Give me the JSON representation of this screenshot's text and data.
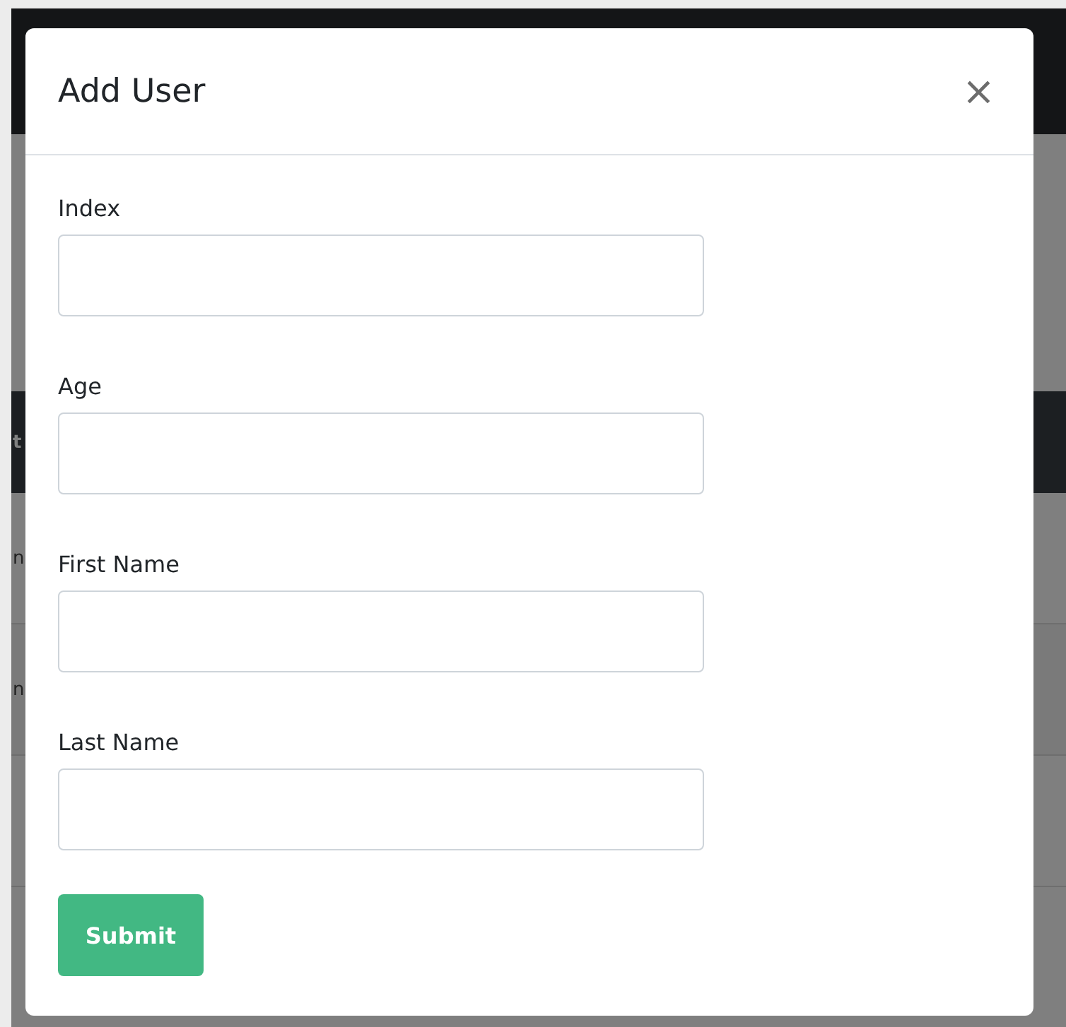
{
  "background": {
    "table_header": "t",
    "rows": [
      {
        "text": "n"
      },
      {
        "text": "n"
      }
    ]
  },
  "modal": {
    "title": "Add User",
    "close": "×",
    "fields": [
      {
        "label": "Index"
      },
      {
        "label": "Age"
      },
      {
        "label": "First Name"
      },
      {
        "label": "Last Name"
      }
    ],
    "submit": "Submit"
  }
}
